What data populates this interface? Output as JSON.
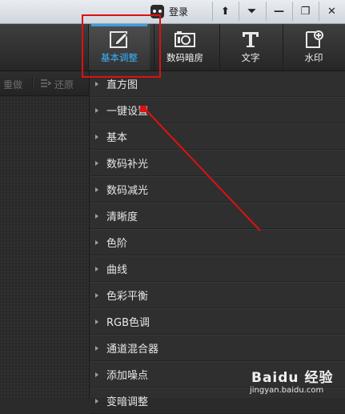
{
  "titlebar": {
    "login_label": "登录",
    "buttons": [
      {
        "name": "skin-button",
        "glyph": "⬆"
      },
      {
        "name": "menu-button",
        "glyph": "⏷"
      },
      {
        "name": "minimize-button",
        "glyph": "—"
      },
      {
        "name": "restore-button",
        "glyph": "❐"
      },
      {
        "name": "close-button",
        "glyph": "✕"
      }
    ]
  },
  "toolbar": {
    "tools": [
      {
        "name": "basic-adjust",
        "label": "基本调整",
        "icon": "edit-icon",
        "active": true
      },
      {
        "name": "digital-darkroom",
        "label": "数码暗房",
        "icon": "camera-icon",
        "active": false
      },
      {
        "name": "text",
        "label": "文字",
        "icon": "text-icon",
        "active": false
      },
      {
        "name": "watermark",
        "label": "水印",
        "icon": "watermark-icon",
        "active": false
      }
    ],
    "accent": "#39b4ff"
  },
  "left_panel": {
    "redo_label": "重做",
    "restore_label": "还原"
  },
  "menu": {
    "items": [
      {
        "label": "直方图"
      },
      {
        "label": "一键设置"
      },
      {
        "label": "基本"
      },
      {
        "label": "数码补光"
      },
      {
        "label": "数码减光"
      },
      {
        "label": "清晰度"
      },
      {
        "label": "色阶"
      },
      {
        "label": "曲线"
      },
      {
        "label": "色彩平衡"
      },
      {
        "label": "RGB色调"
      },
      {
        "label": "通道混合器"
      },
      {
        "label": "添加噪点"
      },
      {
        "label": "变暗调整"
      }
    ]
  },
  "annotation_color": "#e01010",
  "watermark": {
    "brand": "Baidu 经验",
    "url": "jingyan.baidu.com"
  }
}
